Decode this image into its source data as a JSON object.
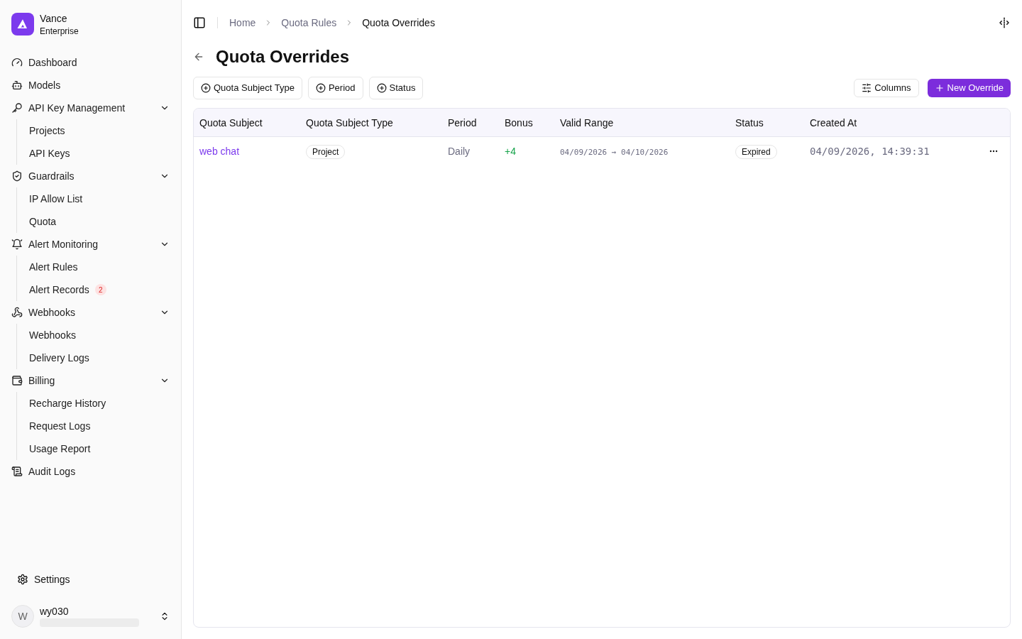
{
  "brand": {
    "name": "Vance",
    "plan": "Enterprise"
  },
  "sidebar": {
    "items": [
      {
        "label": "Dashboard"
      },
      {
        "label": "Models"
      },
      {
        "label": "API Key Management",
        "expanded": true,
        "children": [
          {
            "label": "Projects"
          },
          {
            "label": "API Keys"
          }
        ]
      },
      {
        "label": "Guardrails",
        "expanded": true,
        "children": [
          {
            "label": "IP Allow List"
          },
          {
            "label": "Quota"
          }
        ]
      },
      {
        "label": "Alert Monitoring",
        "expanded": true,
        "children": [
          {
            "label": "Alert Rules"
          },
          {
            "label": "Alert Records",
            "badge": "2"
          }
        ]
      },
      {
        "label": "Webhooks",
        "expanded": true,
        "children": [
          {
            "label": "Webhooks"
          },
          {
            "label": "Delivery Logs"
          }
        ]
      },
      {
        "label": "Billing",
        "expanded": true,
        "children": [
          {
            "label": "Recharge History"
          },
          {
            "label": "Request Logs"
          },
          {
            "label": "Usage Report"
          }
        ]
      },
      {
        "label": "Audit Logs"
      }
    ],
    "settings": "Settings",
    "user": {
      "initial": "W",
      "name": "wy030"
    }
  },
  "breadcrumb": [
    "Home",
    "Quota Rules",
    "Quota Overrides"
  ],
  "page_title": "Quota Overrides",
  "filters": [
    "Quota Subject Type",
    "Period",
    "Status"
  ],
  "actions": {
    "columns": "Columns",
    "new": "New Override"
  },
  "table": {
    "columns": [
      "Quota Subject",
      "Quota Subject Type",
      "Period",
      "Bonus",
      "Valid Range",
      "Status",
      "Created At"
    ],
    "rows": [
      {
        "subject": "web chat",
        "type": "Project",
        "period": "Daily",
        "bonus": "+4",
        "range": "04/09/2026 → 04/10/2026",
        "status": "Expired",
        "created": "04/09/2026, 14:39:31"
      }
    ]
  }
}
